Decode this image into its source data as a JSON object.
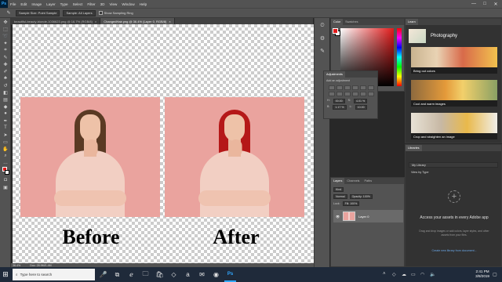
{
  "menubar": {
    "logo": "Ps",
    "items": [
      "File",
      "Edit",
      "Image",
      "Layer",
      "Type",
      "Select",
      "Filter",
      "3D",
      "View",
      "Window",
      "Help"
    ],
    "minimize": "—",
    "maximize": "□",
    "close": "✕"
  },
  "options": {
    "sample_size": "Sample Size: Point Sample",
    "sample": "Sample: All Layers",
    "show_ring": "Show Sampling Ring"
  },
  "tabs": [
    {
      "label": "beautiful-beauty-blonde-1036623.png @ 16.7% (RGB/8)",
      "close": "×"
    },
    {
      "label": "ChangedHair.png @ 36.4% (Layer 0, RGB/8)",
      "close": "×"
    }
  ],
  "canvas": {
    "before_label": "Before",
    "after_label": "After",
    "hair_before": "#5a3a24",
    "hair_after": "#b51818",
    "background_color": "#eaa39e"
  },
  "status": {
    "zoom": "36.4%",
    "doc": "Doc: 28.9M/1.4M"
  },
  "color_panel": {
    "tabs": [
      "Color",
      "Swatches"
    ],
    "fg_color": "#e21b1b"
  },
  "adjustments": {
    "title": "Adjustments",
    "subtitle": "Add an adjustment",
    "fields": [
      {
        "label": "H:",
        "value": "00.00"
      },
      {
        "label": "S:",
        "value": "4.01 %"
      },
      {
        "label": "B:",
        "value": "1.17 %"
      },
      {
        "label": "L:",
        "value": "10.00"
      }
    ]
  },
  "layers_panel": {
    "tabs": [
      "Layers",
      "Channels",
      "Paths"
    ],
    "kind": "Kind",
    "blend_mode": "Normal",
    "opacity": "Opacity: 100%",
    "lock": "Lock:",
    "fill": "Fill: 100%",
    "layer_name": "Layer 0"
  },
  "learn_panel": {
    "tab": "Learn",
    "heading": "Photography",
    "cards": [
      {
        "label": "Bring out colors"
      },
      {
        "label": "Cool and warm images"
      },
      {
        "label": "Crop and straighten an image"
      }
    ]
  },
  "libraries_panel": {
    "tab": "Libraries",
    "library": "My Library",
    "view_by": "View by Type",
    "add_icon": "+",
    "title": "Access your assets in every Adobe app",
    "description": "Drag and drop images or add colors, layer styles, and other assets from your files.",
    "link": "Create new library from document..."
  },
  "taskbar": {
    "start_icon": "⊞",
    "search_placeholder": "Type here to search",
    "time": "2:41 PM",
    "date": "3/8/2019"
  }
}
